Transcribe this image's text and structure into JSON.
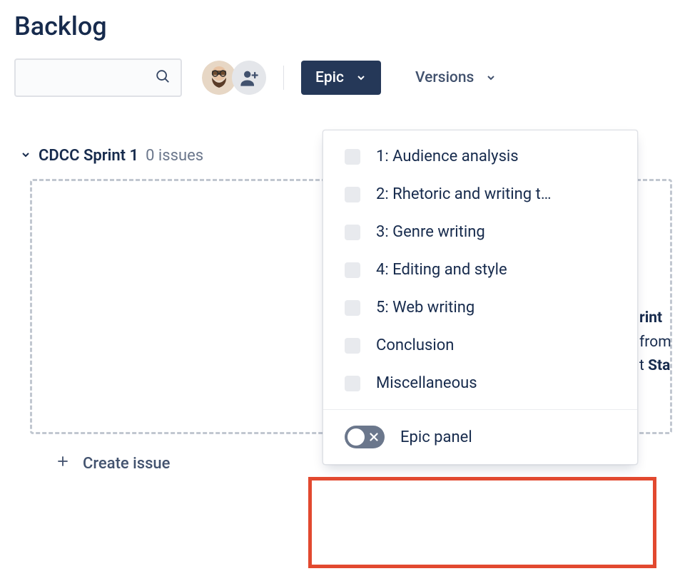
{
  "page": {
    "title": "Backlog"
  },
  "search": {
    "placeholder": ""
  },
  "filters": {
    "epic_label": "Epic",
    "versions_label": "Versions"
  },
  "sprint": {
    "name": "CDCC Sprint 1",
    "count_label": "0 issues"
  },
  "create": {
    "label": "Create issue"
  },
  "epic_dropdown": {
    "items": [
      {
        "label": "1: Audience analysis"
      },
      {
        "label": "2: Rhetoric and writing t…"
      },
      {
        "label": "3: Genre writing"
      },
      {
        "label": "4: Editing and style"
      },
      {
        "label": "5: Web writing"
      },
      {
        "label": "Conclusion"
      },
      {
        "label": "Miscellaneous"
      }
    ],
    "footer_label": "Epic panel",
    "toggle_on": false
  },
  "hint": {
    "line1_suffix": "rint",
    "line2_suffix": "from",
    "line3_prefix": "t ",
    "line3_bold": "Sta"
  }
}
